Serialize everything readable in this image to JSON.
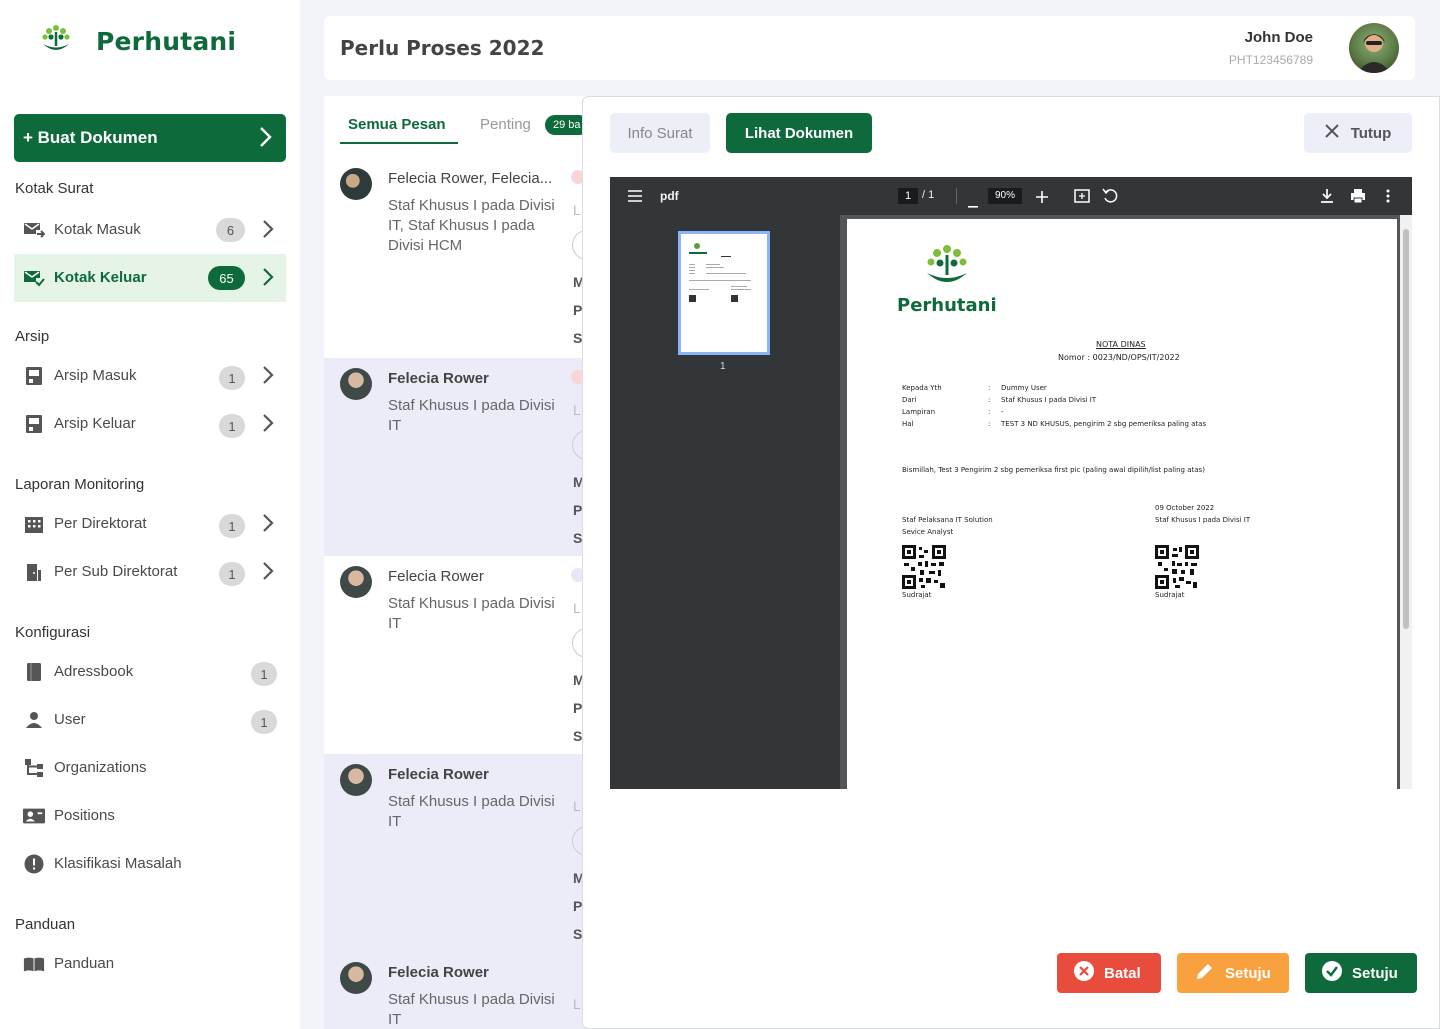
{
  "app": {
    "name": "Perhutani"
  },
  "header": {
    "title": "Perlu Proses 2022",
    "user_name": "John Doe",
    "user_id": "PHT123456789"
  },
  "sidebar": {
    "create_label": "+ Buat Dokumen",
    "sections": {
      "kotak_surat": "Kotak Surat",
      "arsip": "Arsip",
      "laporan": "Laporan Monitoring",
      "konfigurasi": "Konfigurasi",
      "panduan": "Panduan"
    },
    "items": [
      {
        "label": "Kotak Masuk",
        "count": "6"
      },
      {
        "label": "Kotak Keluar",
        "count": "65"
      },
      {
        "label": "Arsip Masuk",
        "count": "1"
      },
      {
        "label": "Arsip Keluar",
        "count": "1"
      },
      {
        "label": "Per Direktorat",
        "count": "1"
      },
      {
        "label": "Per Sub Direktorat",
        "count": "1"
      },
      {
        "label": "Adressbook",
        "count": "1"
      },
      {
        "label": "User",
        "count": "1"
      },
      {
        "label": "Organizations"
      },
      {
        "label": "Positions"
      },
      {
        "label": "Klasifikasi Masalah"
      },
      {
        "label": "Panduan"
      }
    ]
  },
  "inbox": {
    "tabs": {
      "all": "Semua Pesan",
      "important": "Penting",
      "important_badge": "29 ba"
    },
    "messages": [
      {
        "sender": "Felecia Rower, Felecia...",
        "subject": "Staf Khusus I pada Divisi IT, Staf Khusus I pada Divisi HCM",
        "frags": [
          "L",
          "M",
          "P",
          "S"
        ]
      },
      {
        "sender": "Felecia Rower",
        "subject": "Staf Khusus I pada Divisi IT",
        "frags": [
          "L",
          "M",
          "P",
          "S"
        ]
      },
      {
        "sender": "Felecia Rower",
        "subject": "Staf Khusus I pada Divisi IT",
        "frags": [
          "L",
          "M",
          "P",
          "S"
        ]
      },
      {
        "sender": "Felecia Rower",
        "subject": "Staf Khusus I pada Divisi IT",
        "frags": [
          "L",
          "M",
          "P",
          "S"
        ]
      },
      {
        "sender": "Felecia Rower",
        "subject": "Staf Khusus I pada Divisi IT",
        "frags": [
          "L"
        ]
      }
    ]
  },
  "modal": {
    "tab_info": "Info Surat",
    "tab_doc": "Lihat Dokumen",
    "close_label": "Tutup",
    "viewer": {
      "filename": "pdf",
      "page": "1",
      "page_total": "/ 1",
      "zoom": "90%",
      "thumb_page": "1"
    },
    "document": {
      "logo_text": "Perhutani",
      "title": "NOTA DINAS",
      "number": "Nomor : 0023/ND/OPS/IT/2022",
      "fields": [
        {
          "key": "Kepada Yth",
          "value": "Dummy User"
        },
        {
          "key": "Dari",
          "value": "Staf Khusus I pada Divisi IT"
        },
        {
          "key": "Lampiran",
          "value": "-"
        },
        {
          "key": "Hal",
          "value": "TEST 3 ND KHUSUS, pengirim 2 sbg pemeriksa paling atas"
        }
      ],
      "body": "Bismillah, Test 3 Pengirim 2 sbg pemeriksa first pic (paling awal dipilih/list paling atas)",
      "left_sign": {
        "line1": "Staf Pelaksana IT Solution",
        "line2": "Sevice Analyst",
        "name": "Sudrajat"
      },
      "right_sign": {
        "date": "09 October 2022",
        "line1": "Staf Khusus I pada Divisi IT",
        "name": "Sudrajat"
      }
    },
    "actions": {
      "batal": "Batal",
      "setuju_edit": "Setuju",
      "setuju": "Setuju"
    }
  },
  "colors": {
    "brand": "#0e6a3a",
    "danger": "#e74c3c",
    "warning": "#f9a03f",
    "highlight": "#ececf8"
  }
}
